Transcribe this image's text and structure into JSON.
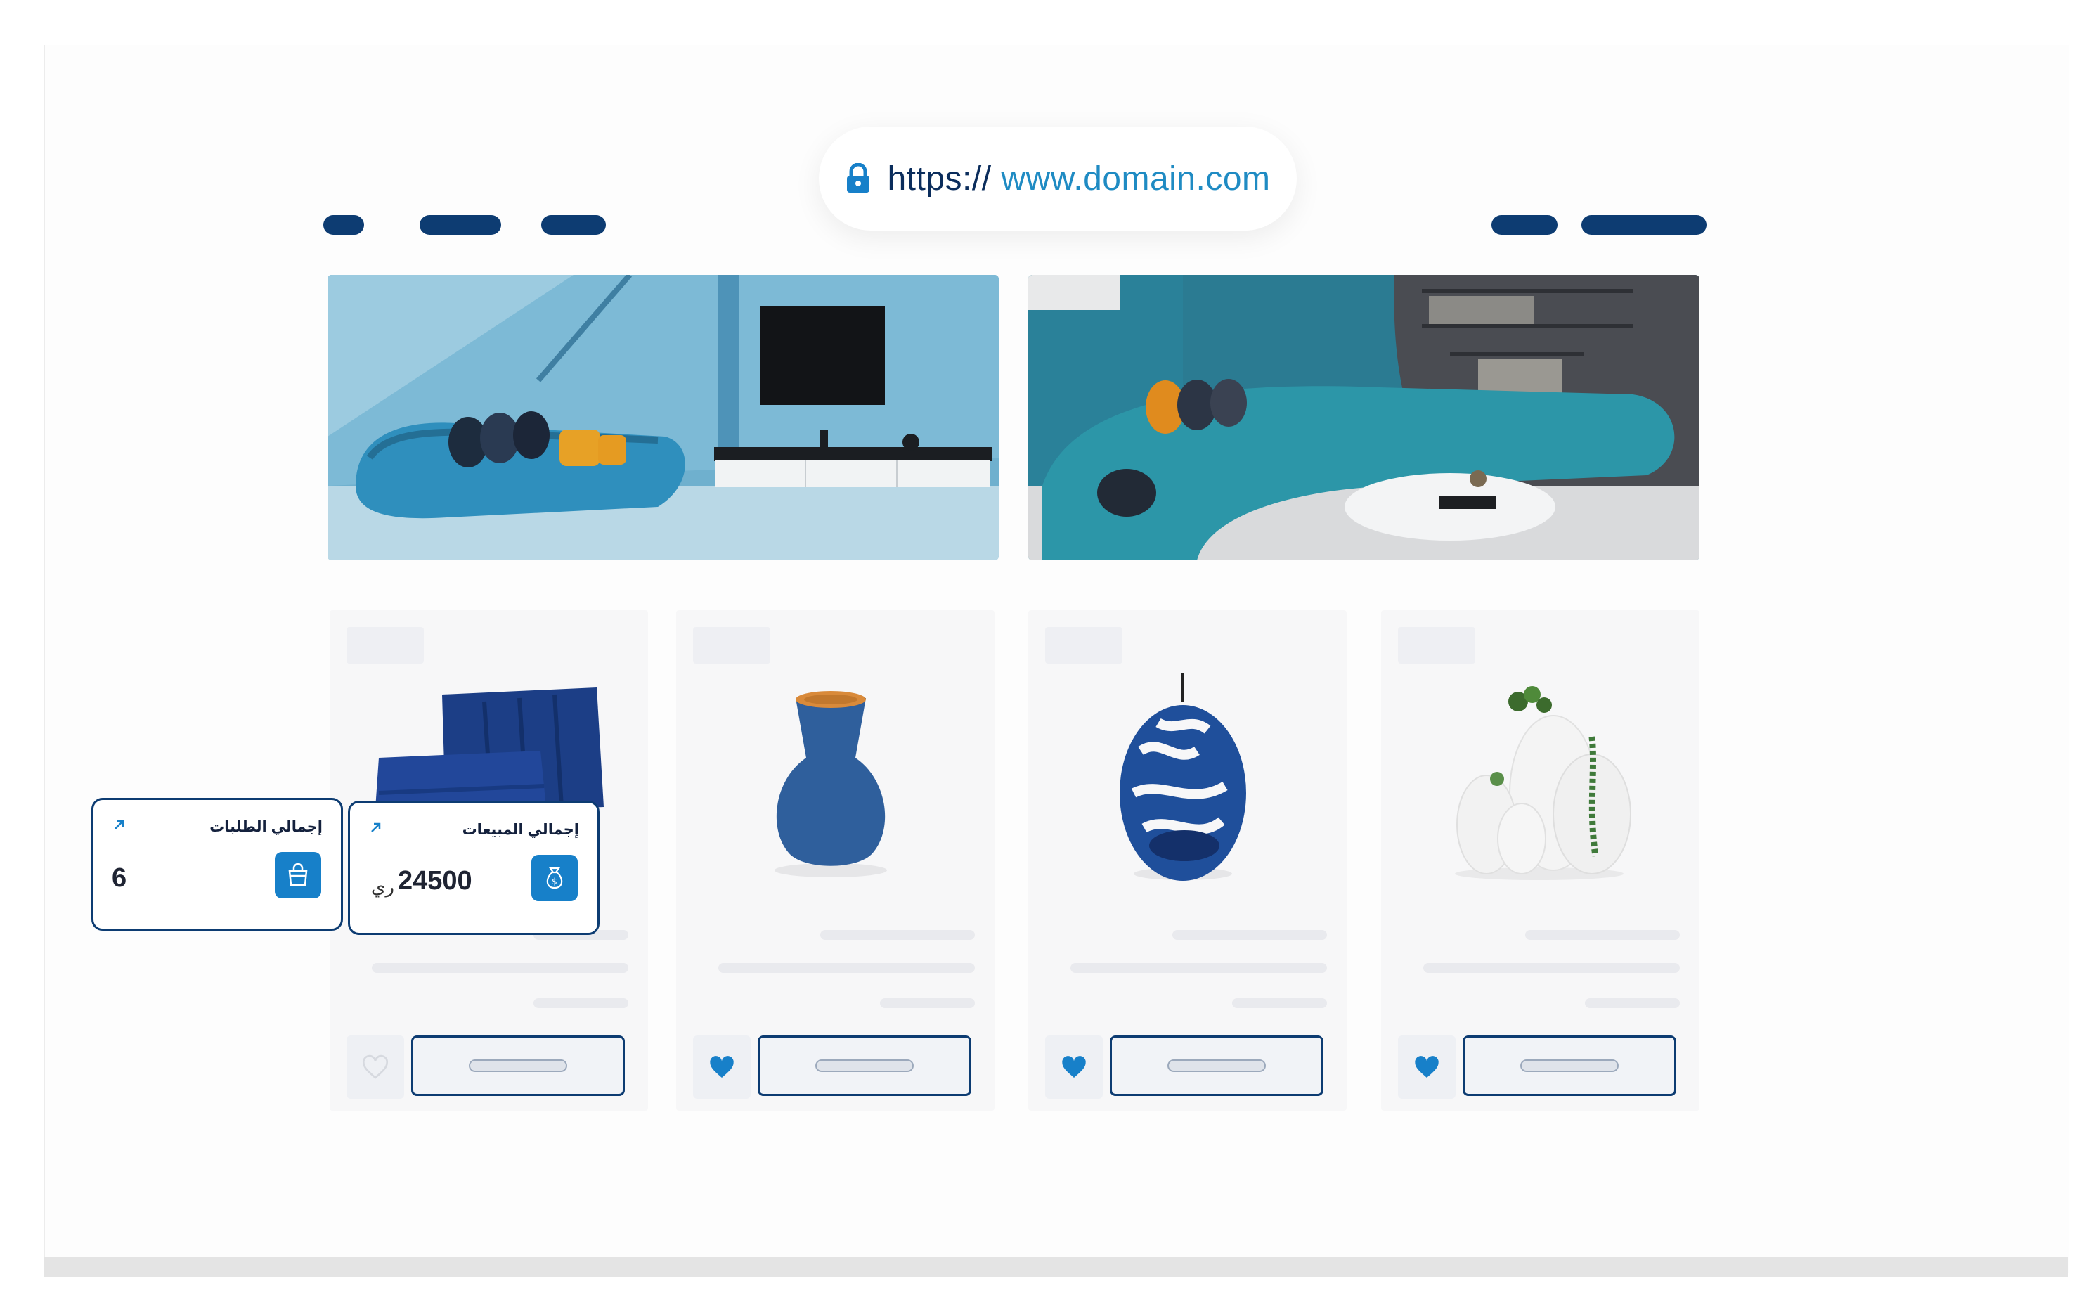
{
  "browser": {
    "url_scheme": "https://",
    "url_host": " www.domain.com"
  },
  "colors": {
    "brand_navy": "#0d3c72",
    "accent_blue": "#1780c9",
    "card_bg": "#f7f7f8"
  },
  "icons": {
    "lock": "lock-icon",
    "heart": "heart-icon",
    "arrow": "arrow-up-right-icon",
    "orders": "shopping-bag-icon",
    "sales": "money-bag-icon"
  },
  "stats": [
    {
      "title": "إجمالي الطلبات",
      "value": "6",
      "currency": ""
    },
    {
      "title": "إجمالي المبيعات",
      "value": "24500",
      "currency": "ري"
    }
  ],
  "products": [
    {
      "image": "blue-cushions",
      "favorited": false
    },
    {
      "image": "blue-vase",
      "favorited": true
    },
    {
      "image": "hanging-egg-chair",
      "favorited": true
    },
    {
      "image": "white-leaf-vases",
      "favorited": true
    }
  ]
}
